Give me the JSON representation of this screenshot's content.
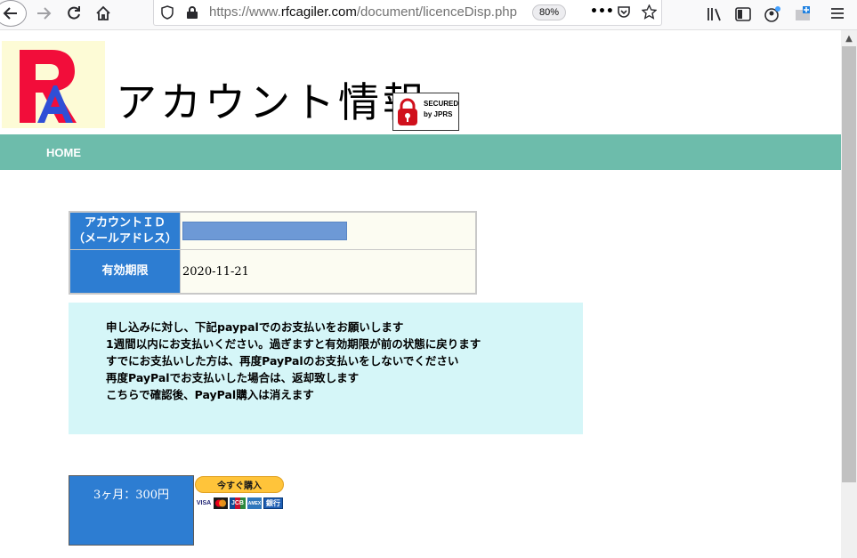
{
  "browser": {
    "url_prefix": "https://www.",
    "url_domain": "rfcagiler.com",
    "url_path": "/document/licenceDisp.php",
    "zoom": "80%"
  },
  "header": {
    "title": "アカウント情報",
    "seal_line1": "SECURED",
    "seal_line2": "by JPRS"
  },
  "nav": {
    "home_label": "HOME"
  },
  "account": {
    "id_label_line1": "アカウントＩＤ",
    "id_label_line2": "（メールアドレス）",
    "expiry_label": "有効期限",
    "expiry_value": "2020-11-21"
  },
  "notice": {
    "lines": [
      "申し込みに対し、下記paypalでのお支払いをお願いします",
      "1週間以内にお支払いください。過ぎますと有効期限が前の状態に戻ります",
      "すでにお支払いした方は、再度PayPalのお支払いをしないでください",
      "再度PayPalでお支払いした場合は、返却致します",
      "こちらで確認後、PayPal購入は消えます"
    ]
  },
  "plan": {
    "label": "3ヶ月：300円",
    "buy_label": "今すぐ購入",
    "cards": [
      "VISA",
      "MC",
      "JCB",
      "AMEX",
      "銀行"
    ]
  },
  "colors": {
    "nav": "#6dbcab",
    "header_cell": "#2d7dd2",
    "notice_bg": "#d5f6f8",
    "buy_button": "#ffc43a"
  }
}
